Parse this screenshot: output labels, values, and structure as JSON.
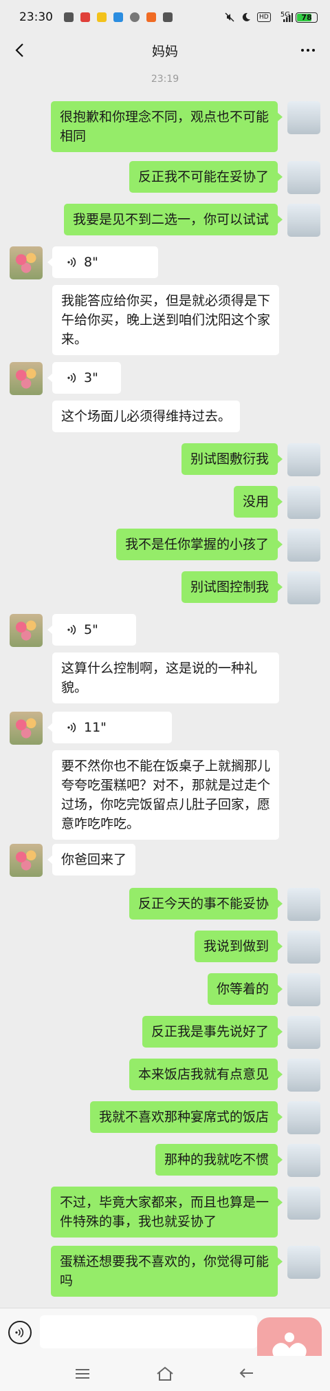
{
  "status": {
    "time": "23:30",
    "network": "5G",
    "battery": "78",
    "battery_level": 0.78
  },
  "header": {
    "title": "妈妈"
  },
  "timestamp": "23:19",
  "messages": [
    {
      "from": "me",
      "text": "很抱歉和你理念不同，观点也不可能相同"
    },
    {
      "from": "me",
      "text": "反正我不可能在妥协了"
    },
    {
      "from": "me",
      "text": "我要是见不到二选一，你可以试试"
    },
    {
      "from": "mom",
      "voice": "8\""
    },
    {
      "from": "mom",
      "text": "我能答应给你买，但是就必须得是下午给你买，晚上送到咱们沈阳这个家来。"
    },
    {
      "from": "mom",
      "voice": "3\""
    },
    {
      "from": "mom",
      "text": "这个场面儿必须得维持过去。"
    },
    {
      "from": "me",
      "text": "别试图敷衍我"
    },
    {
      "from": "me",
      "text": "没用"
    },
    {
      "from": "me",
      "text": "我不是任你掌握的小孩了"
    },
    {
      "from": "me",
      "text": "别试图控制我"
    },
    {
      "from": "mom",
      "voice": "5\""
    },
    {
      "from": "mom",
      "text": "这算什么控制啊，这是说的一种礼貌。"
    },
    {
      "from": "mom",
      "voice": "11\""
    },
    {
      "from": "mom",
      "text": "要不然你也不能在饭桌子上就搁那儿夸夸吃蛋糕吧？对不，那就是过走个过场，你吃完饭留点儿肚子回家，愿意咋吃咋吃。"
    },
    {
      "from": "mom",
      "text": "你爸回来了"
    },
    {
      "from": "me",
      "text": "反正今天的事不能妥协"
    },
    {
      "from": "me",
      "text": "我说到做到"
    },
    {
      "from": "me",
      "text": "你等着的"
    },
    {
      "from": "me",
      "text": "反正我是事先说好了"
    },
    {
      "from": "me",
      "text": "本来饭店我就有点意见"
    },
    {
      "from": "me",
      "text": "我就不喜欢那种宴席式的饭店"
    },
    {
      "from": "me",
      "text": "那种的我就吃不惯"
    },
    {
      "from": "me",
      "text": "不过，毕竟大家都来，而且也算是一件特殊的事，我也就妥协了"
    },
    {
      "from": "me",
      "text": "蛋糕还想要我不喜欢的，你觉得可能吗"
    }
  ],
  "input": {
    "value": ""
  },
  "icons": {
    "back": "chevron-left-icon",
    "more": "more-icon",
    "voice": "voice-icon",
    "heart": "heart-icon",
    "menu": "menu-icon",
    "home": "home-icon",
    "return": "return-icon"
  },
  "colors": {
    "me_bubble": "#95ec69",
    "mom_bubble": "#ffffff",
    "background": "#ededed"
  }
}
